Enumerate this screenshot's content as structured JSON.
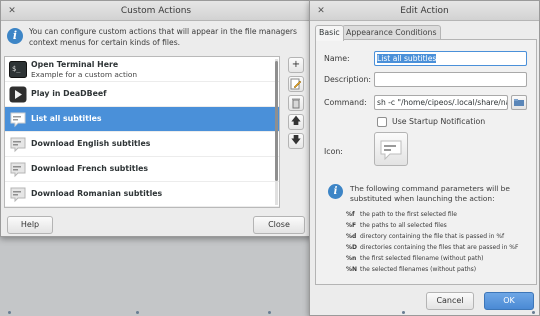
{
  "custom_actions": {
    "title": "Custom Actions",
    "info": "You can configure custom actions that will appear in the file managers context menus for certain kinds of files.",
    "actions": [
      {
        "name": "Open Terminal Here",
        "description": "Example for a custom action",
        "icon": "terminal-icon"
      },
      {
        "name": "Play in DeaDBeef",
        "description": "",
        "icon": "deadbeef-icon"
      },
      {
        "name": "List all subtitles",
        "description": "",
        "icon": "subtitle-icon",
        "selected": true
      },
      {
        "name": "Download English subtitles",
        "description": "",
        "icon": "subtitle-icon"
      },
      {
        "name": "Download French subtitles",
        "description": "",
        "icon": "subtitle-icon"
      },
      {
        "name": "Download Romanian subtitles",
        "description": "",
        "icon": "subtitle-icon"
      }
    ],
    "help_label": "Help",
    "close_label": "Close"
  },
  "edit_action": {
    "title": "Edit Action",
    "tabs": [
      "Basic",
      "Appearance Conditions"
    ],
    "active_tab": "Basic",
    "name_label": "Name:",
    "name_value": "List all subtitles",
    "description_label": "Description:",
    "description_value": "",
    "command_label": "Command:",
    "command_value": "sh -c \"/home/cipeos/.local/share/naut",
    "startup_notification_label": "Use Startup Notification",
    "startup_notification_checked": false,
    "icon_label": "Icon:",
    "params_info": "The following command parameters will be substituted when launching the action:",
    "params": [
      {
        "code": "%f",
        "text": "the path to the first selected file"
      },
      {
        "code": "%F",
        "text": "the paths to all selected files"
      },
      {
        "code": "%d",
        "text": "directory containing the file that is passed in %f"
      },
      {
        "code": "%D",
        "text": "directories containing the files that are passed in %F"
      },
      {
        "code": "%n",
        "text": "the first selected filename (without path)"
      },
      {
        "code": "%N",
        "text": "the selected filenames (without paths)"
      }
    ],
    "cancel_label": "Cancel",
    "ok_label": "OK"
  },
  "colors": {
    "accent": "#4a90d9",
    "info_icon": "#3d85c6",
    "window_bg": "#ececec",
    "desktop": "#c4c6c8"
  }
}
